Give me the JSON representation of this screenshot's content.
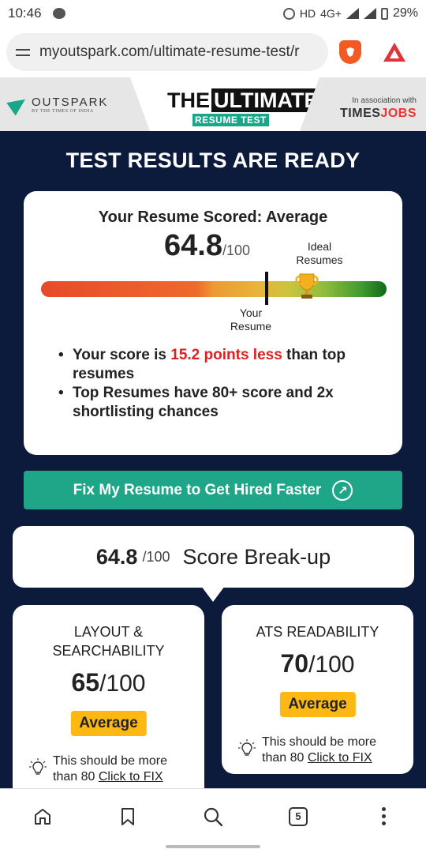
{
  "status_bar": {
    "time": "10:46",
    "signal_text": "HD",
    "network": "4G+",
    "battery": "29%"
  },
  "browser": {
    "url": "myoutspark.com/ultimate-resume-test/r"
  },
  "header": {
    "outspark": "OUTSPARK",
    "outspark_sub": "BY THE TIMES OF INDIA",
    "the": "THE",
    "ultimate": "ULTIMATE",
    "resume_test": "RESUME TEST",
    "assoc_line": "In association with",
    "times": "TIMES",
    "jobs": "JOBS"
  },
  "results": {
    "title": "TEST RESULTS ARE READY",
    "heading": "Your Resume Scored: Average",
    "score": "64.8",
    "score_max": "/100",
    "ideal_label_1": "Ideal",
    "ideal_label_2": "Resumes",
    "your_label_1": "Your",
    "your_label_2": "Resume",
    "bullet1_prefix": "Your score is ",
    "bullet1_highlight": "15.2 points less",
    "bullet1_suffix": " than top resumes",
    "bullet2": "Top Resumes have 80+ score and 2x shortlisting chances"
  },
  "cta": {
    "label": "Fix My Resume to Get Hired Faster"
  },
  "breakup": {
    "score": "64.8",
    "max": "/100",
    "label": "Score Break-up"
  },
  "cards": [
    {
      "title_1": "LAYOUT &",
      "title_2": "SEARCHABILITY",
      "score": "65",
      "max": "/100",
      "badge": "Average",
      "tip_text": "This should be more than 80 ",
      "tip_link": "Click to FIX"
    },
    {
      "title_1": "ATS READABILITY",
      "score": "70",
      "max": "/100",
      "badge": "Average",
      "tip_text": "This should be more than 80 ",
      "tip_link": "Click to FIX"
    }
  ],
  "nav": {
    "tab_count": "5"
  },
  "colors": {
    "navy": "#0c1b3b",
    "green": "#1fa587",
    "badge": "#fdb813",
    "highlight_red": "#e02020"
  }
}
